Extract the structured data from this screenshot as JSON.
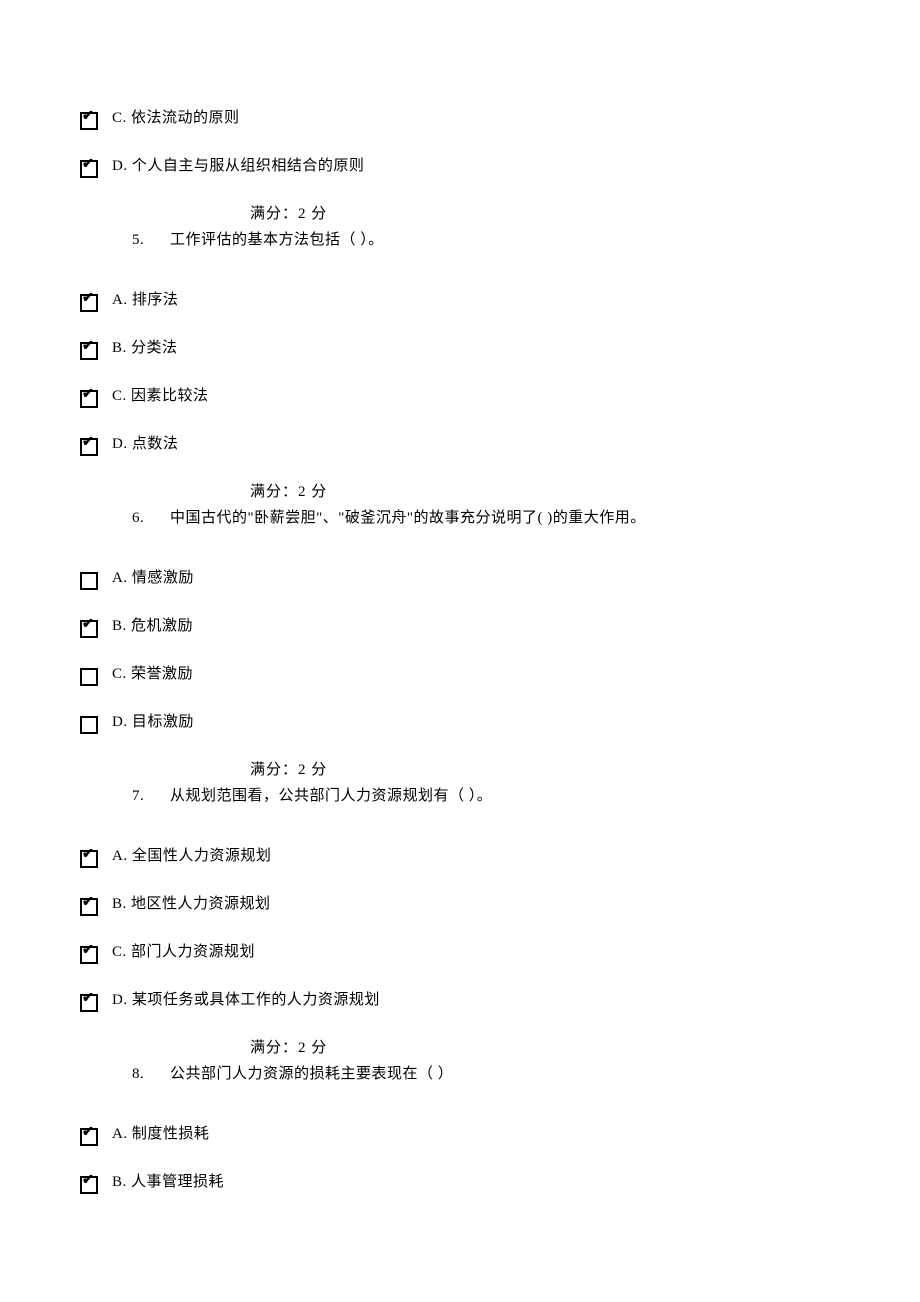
{
  "orphan_options": [
    {
      "letter": "C",
      "text": "依法流动的原则",
      "checked": true
    },
    {
      "letter": "D",
      "text": "个人自主与服从组织相结合的原则",
      "checked": true
    }
  ],
  "score_label_prefix": "满分：",
  "score_value": "2",
  "score_label_suffix": "  分",
  "questions": [
    {
      "num": "5.",
      "text": "工作评估的基本方法包括（   ）。",
      "options": [
        {
          "letter": "A",
          "text": "排序法",
          "checked": true
        },
        {
          "letter": "B",
          "text": "分类法",
          "checked": true
        },
        {
          "letter": "C",
          "text": "因素比较法",
          "checked": true
        },
        {
          "letter": "D",
          "text": "点数法",
          "checked": true
        }
      ]
    },
    {
      "num": "6.",
      "text": "中国古代的\"卧薪尝胆\"、\"破釜沉舟\"的故事充分说明了(    )的重大作用。",
      "options": [
        {
          "letter": "A",
          "text": "情感激励",
          "checked": false
        },
        {
          "letter": "B",
          "text": "危机激励",
          "checked": true
        },
        {
          "letter": "C",
          "text": "荣誉激励",
          "checked": false
        },
        {
          "letter": "D",
          "text": "目标激励",
          "checked": false
        }
      ]
    },
    {
      "num": "7.",
      "text": "从规划范围看，公共部门人力资源规划有（   ）。",
      "options": [
        {
          "letter": "A",
          "text": "全国性人力资源规划",
          "checked": true
        },
        {
          "letter": "B",
          "text": "地区性人力资源规划",
          "checked": true
        },
        {
          "letter": "C",
          "text": "部门人力资源规划",
          "checked": true
        },
        {
          "letter": "D",
          "text": "某项任务或具体工作的人力资源规划",
          "checked": true
        }
      ]
    },
    {
      "num": "8.",
      "text": "公共部门人力资源的损耗主要表现在（   ）",
      "options": [
        {
          "letter": "A",
          "text": "制度性损耗",
          "checked": true
        },
        {
          "letter": "B",
          "text": "人事管理损耗",
          "checked": true
        }
      ]
    }
  ]
}
